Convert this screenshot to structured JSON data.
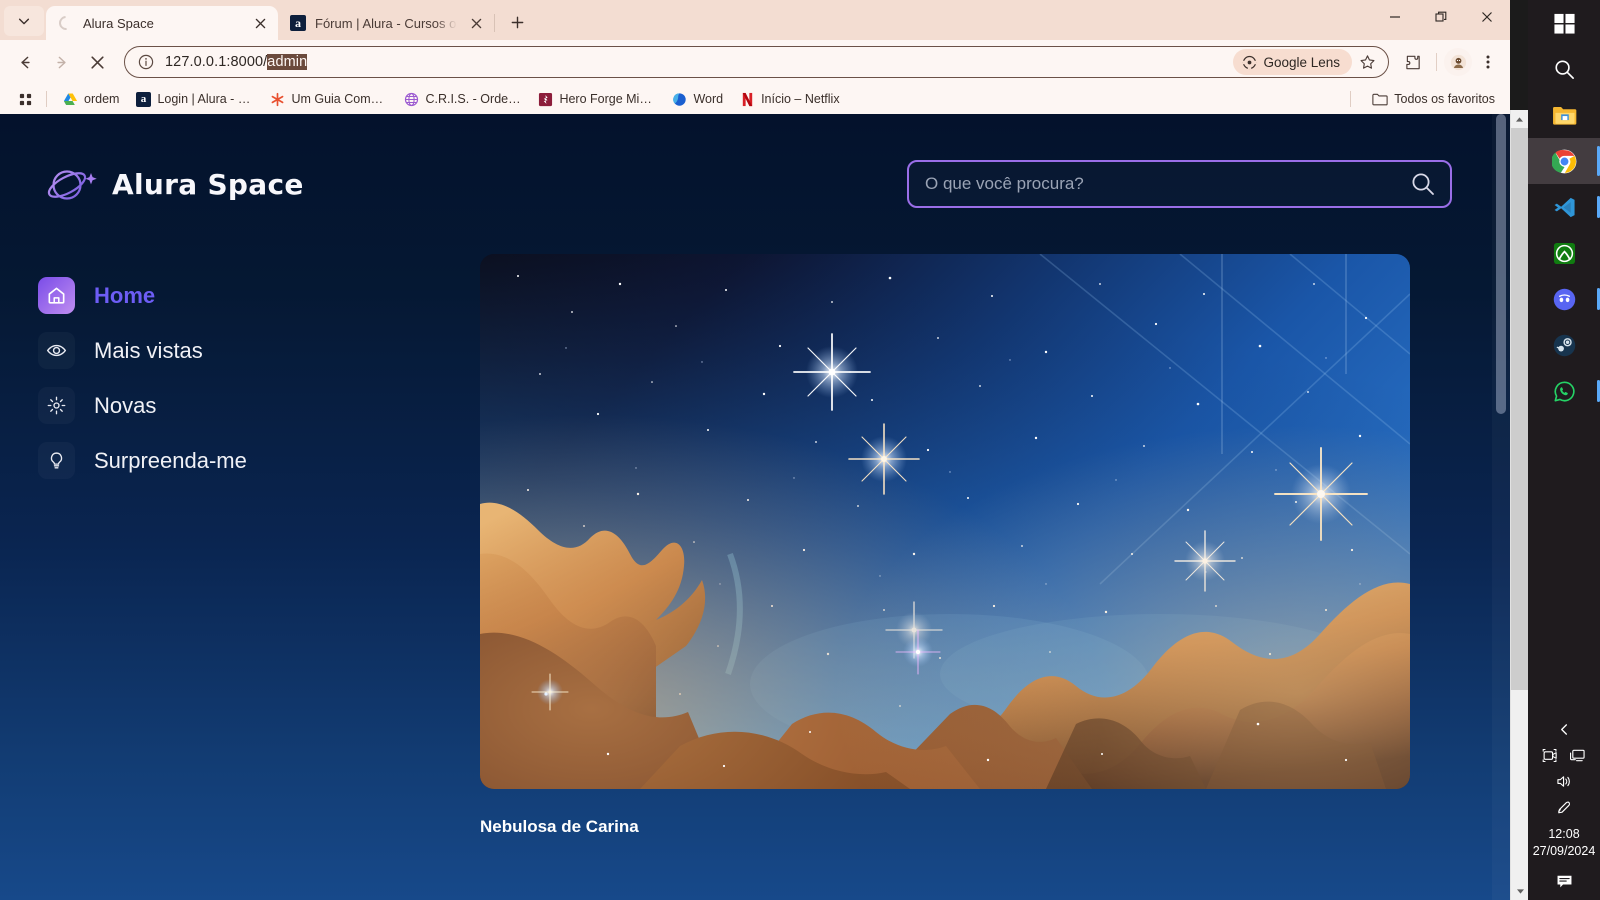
{
  "browser": {
    "tabs": [
      {
        "title": "Alura Space",
        "favicon": "loading-spinner",
        "active": true
      },
      {
        "title": "Fórum | Alura - Cursos online d",
        "favicon": "alura-a-icon",
        "active": false
      }
    ],
    "new_tab_label": "+",
    "window_controls": {
      "minimize": "minimize-icon",
      "restore": "restore-icon",
      "close": "close-icon"
    },
    "toolbar": {
      "back": "back-arrow-icon",
      "forward": "forward-arrow-icon",
      "stop": "stop-loading-icon",
      "url_prefix": "127.0.0.1:8000/",
      "url_selected": "admin",
      "url_full": "127.0.0.1:8000/admin",
      "site_info": "info-circle-icon",
      "lens_label": "Google Lens",
      "bookmark_star": "star-icon",
      "extensions": "extensions-icon",
      "profile": "profile-avatar-icon",
      "menu": "three-dots-menu-icon"
    },
    "bookmarks": {
      "apps_icon": "apps-grid-icon",
      "items": [
        {
          "label": "ordem",
          "icon": "google-drive-icon"
        },
        {
          "label": "Login | Alura - Curs...",
          "icon": "alura-a-icon"
        },
        {
          "label": "Um Guia Completo...",
          "icon": "asterisk-icon"
        },
        {
          "label": "C.R.I.S. - Ordem Par...",
          "icon": "globe-purple-icon"
        },
        {
          "label": "Hero Forge Miniatu...",
          "icon": "heroforge-icon"
        },
        {
          "label": "Word",
          "icon": "word-icon"
        },
        {
          "label": "Início – Netflix",
          "icon": "netflix-icon"
        }
      ],
      "all_bookmarks_label": "Todos os favoritos",
      "all_bookmarks_icon": "folder-icon"
    }
  },
  "app": {
    "logo_text": "Alura Space",
    "logo_icon": "planet-ring-icon",
    "search": {
      "placeholder": "O que você procura?",
      "value": "",
      "icon": "search-icon"
    },
    "sidebar": {
      "items": [
        {
          "label": "Home",
          "icon": "home-icon",
          "active": true
        },
        {
          "label": "Mais vistas",
          "icon": "eye-icon",
          "active": false
        },
        {
          "label": "Novas",
          "icon": "sparkle-icon",
          "active": false
        },
        {
          "label": "Surpreenda-me",
          "icon": "lightbulb-icon",
          "active": false
        }
      ]
    },
    "gallery": {
      "cards": [
        {
          "title": "Nebulosa de Carina",
          "image_alt": "nebula-photo"
        }
      ]
    },
    "colors": {
      "accent_purple": "#6d5df5",
      "search_border": "#9a6ee8",
      "bg_top": "#04122c",
      "bg_bottom": "#17498a",
      "card_title": "#ffffff"
    }
  },
  "os": {
    "taskbar": {
      "items": [
        {
          "name": "start-windows-icon",
          "running": false,
          "active": false
        },
        {
          "name": "search-icon",
          "running": false,
          "active": false
        },
        {
          "name": "file-explorer-icon",
          "running": false,
          "active": false
        },
        {
          "name": "chrome-icon",
          "running": true,
          "active": true
        },
        {
          "name": "vscode-icon",
          "running": true,
          "active": false
        },
        {
          "name": "xbox-icon",
          "running": false,
          "active": false
        },
        {
          "name": "discord-icon",
          "running": true,
          "active": false
        },
        {
          "name": "steam-icon",
          "running": false,
          "active": false
        },
        {
          "name": "whatsapp-icon",
          "running": true,
          "active": false
        }
      ]
    },
    "tray": {
      "expand": "chevron-left-icon",
      "icons": [
        "camera-icon",
        "display-icon",
        "volume-icon",
        "pen-icon"
      ],
      "time": "12:08",
      "date": "27/09/2024",
      "notifications": "notification-icon"
    }
  }
}
